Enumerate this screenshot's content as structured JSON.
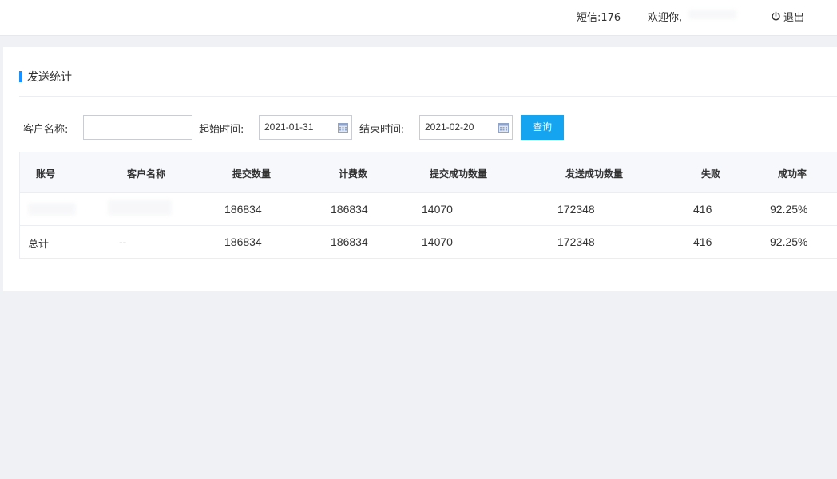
{
  "header": {
    "sms_count_label": "短信:176",
    "welcome_label": "欢迎你,",
    "logout_label": "退出"
  },
  "panel": {
    "title": "发送统计"
  },
  "filters": {
    "customer_label": "客户名称:",
    "customer_value": "",
    "start_label": "起始时间:",
    "start_value": "2021-01-31",
    "end_label": "结束时间:",
    "end_value": "2021-02-20",
    "query_label": "查询"
  },
  "table": {
    "columns": [
      "账号",
      "客户名称",
      "提交数量",
      "计费数",
      "提交成功数量",
      "发送成功数量",
      "失败",
      "成功率"
    ],
    "rows": [
      [
        "",
        "",
        "186834",
        "186834",
        "14070",
        "172348",
        "416",
        "92.25%"
      ],
      [
        "总计",
        "--",
        "186834",
        "186834",
        "14070",
        "172348",
        "416",
        "92.25%"
      ]
    ]
  },
  "colors": {
    "accent": "#15a5f0",
    "title_bar": "#1890ff"
  }
}
